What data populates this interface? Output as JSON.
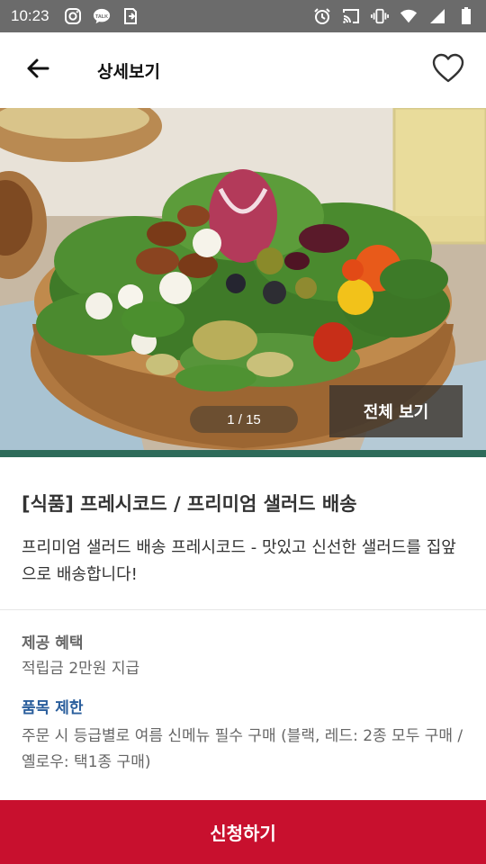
{
  "status_bar": {
    "time": "10:23",
    "left_icons": [
      "instagram-icon",
      "talk-icon",
      "exit-icon"
    ],
    "right_icons": [
      "alarm-icon",
      "cast-icon",
      "vibrate-icon",
      "wifi-icon",
      "signal-icon",
      "battery-icon"
    ]
  },
  "app_bar": {
    "title": "상세보기",
    "back_icon": "back-arrow-icon",
    "favorite_icon": "heart-icon"
  },
  "hero": {
    "image": "salad-bowl-photo",
    "page_indicator": "1 / 15",
    "current_page": 1,
    "total_pages": 15,
    "view_all_label": "전체 보기"
  },
  "product": {
    "title": "[식품] 프레시코드 / 프리미엄 샐러드 배송",
    "description": "프리미엄 샐러드 배송 프레시코드 - 맛있고 신선한 샐러드를 집앞으로 배송합니다!"
  },
  "benefit": {
    "heading": "제공 혜택",
    "text": "적립금 2만원 지급"
  },
  "restriction": {
    "heading": "품목 제한",
    "text": "주문 시 등급별로 여름 신메뉴 필수 구매 (블랙, 레드: 2종 모두 구매 / 옐로우: 택1종 구매)"
  },
  "apply_button": {
    "label": "신청하기"
  },
  "colors": {
    "status_bar": "#6b6b6b",
    "accent_green": "#2e6b5a",
    "restriction_blue": "#2a5e9c",
    "apply_red": "#c8102e"
  }
}
